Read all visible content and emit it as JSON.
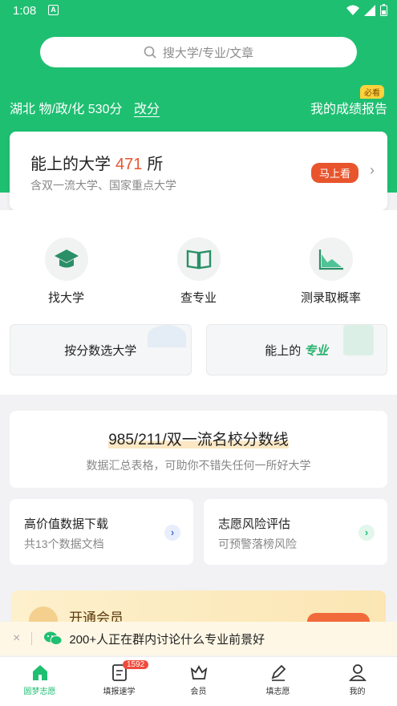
{
  "status": {
    "time": "1:08",
    "app_badge": "A"
  },
  "search": {
    "placeholder": "搜大学/专业/文章"
  },
  "profile": {
    "summary": "湖北 物/政/化 530分",
    "change_label": "改分",
    "report_label": "我的成绩报告",
    "report_badge": "必看"
  },
  "main_card": {
    "title_prefix": "能上的大学",
    "count": "471",
    "title_suffix": "所",
    "subtitle": "含双一流大学、国家重点大学",
    "button": "马上看",
    "chevron": "›"
  },
  "tools": [
    {
      "label": "找大学",
      "icon": "graduation-cap-icon"
    },
    {
      "label": "查专业",
      "icon": "book-icon"
    },
    {
      "label": "测录取概率",
      "icon": "chart-icon"
    }
  ],
  "pills": {
    "left": "按分数选大学",
    "right_prefix": "能上的",
    "right_italic": "专业"
  },
  "score_card": {
    "title": "985/211/双一流名校分数线",
    "subtitle": "数据汇总表格，可助你不错失任何一所好大学"
  },
  "mini_cards": [
    {
      "title": "高价值数据下载",
      "subtitle": "共13个数据文档",
      "arrow": "›",
      "color": "#4c6fd8",
      "bg": "#e8eefb"
    },
    {
      "title": "志愿风险评估",
      "subtitle": "可预警落榜风险",
      "arrow": "›",
      "color": "#1fbf72",
      "bg": "#e3f6ec"
    }
  ],
  "vip": {
    "title": "开通会员"
  },
  "notice": {
    "close": "×",
    "text": "200+人正在群内讨论什么专业前景好"
  },
  "tabbar": [
    {
      "label": "圆梦志愿",
      "icon": "home-icon",
      "active": true
    },
    {
      "label": "填报速学",
      "icon": "document-icon",
      "badge": "1592"
    },
    {
      "label": "会员",
      "icon": "crown-icon"
    },
    {
      "label": "填志愿",
      "icon": "pen-icon"
    },
    {
      "label": "我的",
      "icon": "user-icon"
    }
  ],
  "colors": {
    "primary": "#1fbf72",
    "accent": "#e8552d"
  }
}
